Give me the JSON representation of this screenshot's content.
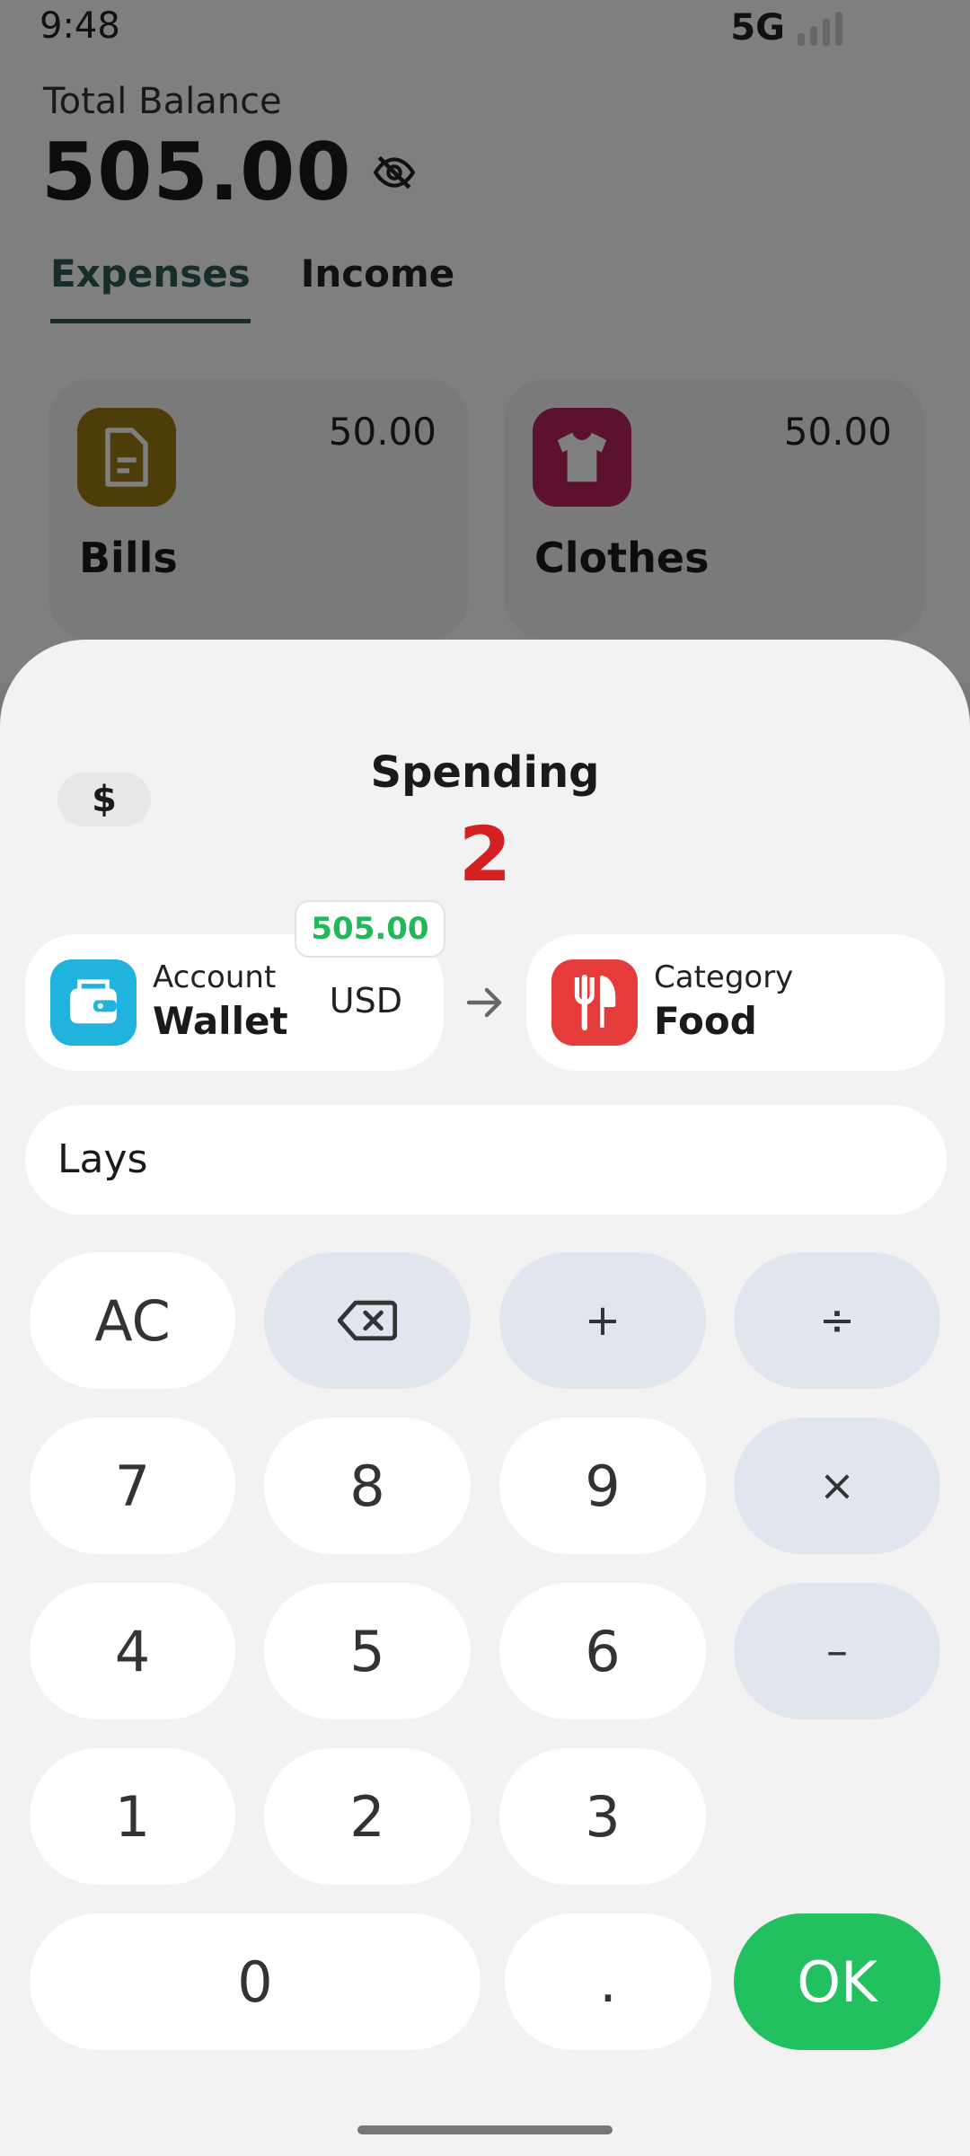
{
  "status_bar": {
    "time": "9:48",
    "network": "5G"
  },
  "summary": {
    "balance_label": "Total Balance",
    "balance_value": "505.00",
    "tabs": [
      {
        "label": "Expenses",
        "active": true
      },
      {
        "label": "Income",
        "active": false
      }
    ],
    "categories": [
      {
        "name": "Bills",
        "amount": "50.00",
        "icon": "document-icon",
        "color": "#9b7a10"
      },
      {
        "name": "Clothes",
        "amount": "50.00",
        "icon": "tshirt-icon",
        "color": "#b8225f"
      }
    ]
  },
  "sheet": {
    "currency_symbol": "$",
    "title": "Spending",
    "amount": "2",
    "amount_color": "#d42020",
    "account": {
      "label": "Account",
      "value": "Wallet",
      "currency": "USD",
      "balance": "505.00",
      "icon": "wallet-icon",
      "color": "#1fb3dd"
    },
    "category": {
      "label": "Category",
      "value": "Food",
      "icon": "fork-knife-icon",
      "color": "#e63b3b"
    },
    "note": "Lays",
    "keypad": {
      "clear": "AC",
      "plus": "+",
      "divide": "÷",
      "multiply": "×",
      "minus": "–",
      "dot": ".",
      "ok": "OK",
      "digits": [
        "0",
        "1",
        "2",
        "3",
        "4",
        "5",
        "6",
        "7",
        "8",
        "9"
      ]
    }
  }
}
